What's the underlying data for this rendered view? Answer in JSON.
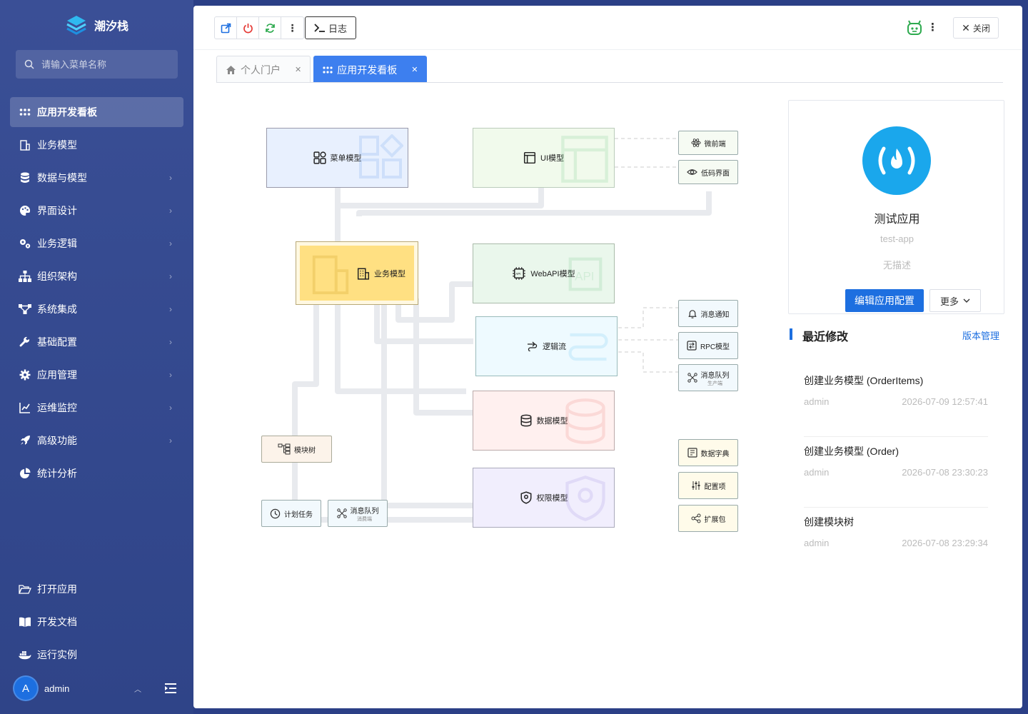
{
  "app": {
    "name": "潮汐栈"
  },
  "sidebar": {
    "search_placeholder": "请输入菜单名称",
    "items": [
      {
        "label": "应用开发看板",
        "icon": "grid-icon",
        "active": true,
        "has_children": false
      },
      {
        "label": "业务模型",
        "icon": "building-icon",
        "has_children": false
      },
      {
        "label": "数据与模型",
        "icon": "database-icon",
        "has_children": true
      },
      {
        "label": "界面设计",
        "icon": "palette-icon",
        "has_children": true
      },
      {
        "label": "业务逻辑",
        "icon": "gears-icon",
        "has_children": true
      },
      {
        "label": "组织架构",
        "icon": "org-chart-icon",
        "has_children": true
      },
      {
        "label": "系统集成",
        "icon": "network-icon",
        "has_children": true
      },
      {
        "label": "基础配置",
        "icon": "wrench-icon",
        "has_children": true
      },
      {
        "label": "应用管理",
        "icon": "gear-icon",
        "has_children": true
      },
      {
        "label": "运维监控",
        "icon": "line-chart-icon",
        "has_children": true
      },
      {
        "label": "高级功能",
        "icon": "rocket-icon",
        "has_children": true
      },
      {
        "label": "统计分析",
        "icon": "pie-chart-icon",
        "has_children": false
      }
    ],
    "bottom_items": [
      {
        "label": "打开应用",
        "icon": "folder-open-icon"
      },
      {
        "label": "开发文档",
        "icon": "book-icon"
      },
      {
        "label": "运行实例",
        "icon": "docker-icon"
      }
    ],
    "user": {
      "initial": "A",
      "name": "admin"
    }
  },
  "toolbar": {
    "log_label": "日志",
    "close_label": "关闭"
  },
  "tabs": [
    {
      "label": "个人门户",
      "icon": "home-icon",
      "active": false
    },
    {
      "label": "应用开发看板",
      "icon": "grid-icon",
      "active": true
    }
  ],
  "diagram": {
    "menu_model": "菜单模型",
    "ui_model": "UI模型",
    "micro_frontend": "微前端",
    "lowcode": "低码界面",
    "business_model": "业务模型",
    "webapi_model": "WebAPI模型",
    "logic_flow": "逻辑流",
    "notify": "消息通知",
    "rpc_model": "RPC模型",
    "mq_producer": "消息队列",
    "mq_producer_sub": "生产端",
    "data_model": "数据模型",
    "module_tree": "模块树",
    "data_dict": "数据字典",
    "config_item": "配置项",
    "ext_pkg": "扩展包",
    "permission_model": "权限模型",
    "schedule": "计划任务",
    "mq_consumer": "消息队列",
    "mq_consumer_sub": "消费端"
  },
  "app_card": {
    "name": "测试应用",
    "code": "test-app",
    "desc": "无描述",
    "edit_label": "编辑应用配置",
    "more_label": "更多"
  },
  "recent": {
    "title": "最近修改",
    "version_link": "版本管理",
    "items": [
      {
        "title": "创建业务模型 (OrderItems)",
        "user": "admin",
        "time": "2026-07-09 12:57:41"
      },
      {
        "title": "创建业务模型 (Order)",
        "user": "admin",
        "time": "2026-07-08 23:30:23"
      },
      {
        "title": "创建模块树",
        "user": "admin",
        "time": "2026-07-08 23:29:34"
      }
    ]
  },
  "colors": {
    "accent": "#1d6fe0",
    "sidebar": "#3a4f96",
    "tab_active": "#3d7fef"
  }
}
